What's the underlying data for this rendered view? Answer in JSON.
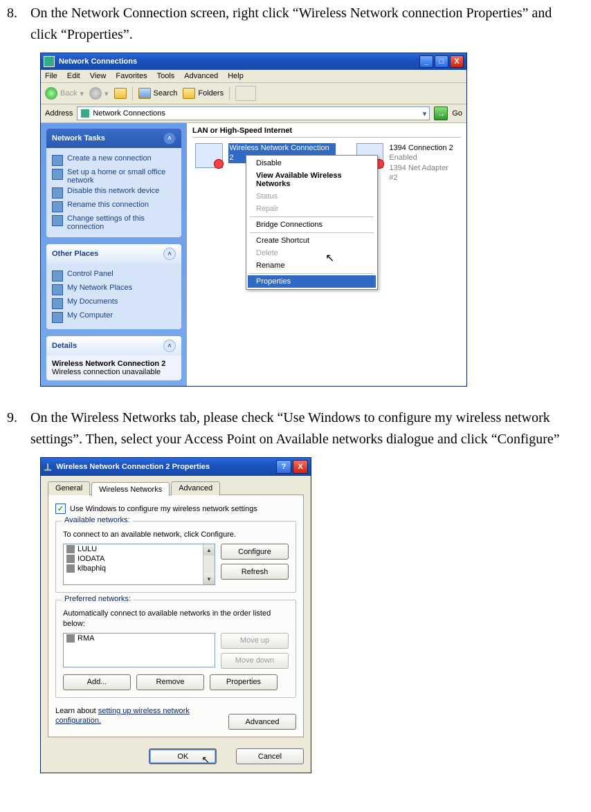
{
  "step8": {
    "num": "8.",
    "text": "On the Network Connection screen, right click “Wireless Network connection Properties” and click “Properties”."
  },
  "step9": {
    "num": "9.",
    "text": "On the Wireless Networks tab, please check “Use Windows to configure my wireless network settings”. Then, select your Access Point on Available networks dialogue and click “Configure”"
  },
  "win1": {
    "title": "Network Connections",
    "menu": [
      "File",
      "Edit",
      "View",
      "Favorites",
      "Tools",
      "Advanced",
      "Help"
    ],
    "toolbar": {
      "back": "Back",
      "search": "Search",
      "folders": "Folders"
    },
    "address": {
      "label": "Address",
      "value": "Network Connections",
      "go": "Go"
    },
    "tasks": {
      "title": "Network Tasks",
      "items": [
        "Create a new connection",
        "Set up a home or small office network",
        "Disable this network device",
        "Rename this connection",
        "Change settings of this connection"
      ]
    },
    "places": {
      "title": "Other Places",
      "items": [
        "Control Panel",
        "My Network Places",
        "My Documents",
        "My Computer"
      ]
    },
    "details": {
      "title": "Details",
      "name": "Wireless Network Connection 2",
      "status": "Wireless connection unavailable"
    },
    "section": "LAN or High-Speed Internet",
    "conn1": {
      "name": "Wireless Network Connection 2"
    },
    "conn2": {
      "name": "1394 Connection 2",
      "status": "Enabled",
      "device": "1394 Net Adapter #2"
    },
    "ctx": {
      "disable": "Disable",
      "view": "View Available Wireless Networks",
      "status": "Status",
      "repair": "Repair",
      "bridge": "Bridge Connections",
      "shortcut": "Create Shortcut",
      "delete": "Delete",
      "rename": "Rename",
      "properties": "Properties"
    }
  },
  "win2": {
    "title": "Wireless Network Connection 2 Properties",
    "tabs": {
      "general": "General",
      "wireless": "Wireless Networks",
      "advanced": "Advanced"
    },
    "check": "Use Windows to configure my wireless network settings",
    "avail": {
      "title": "Available networks:",
      "hint": "To connect to an available network, click Configure.",
      "items": [
        "LULU",
        "IODATA",
        "klbaphiq"
      ],
      "configure": "Configure",
      "refresh": "Refresh"
    },
    "pref": {
      "title": "Preferred networks:",
      "hint": "Automatically connect to available networks in the order listed below:",
      "items": [
        "RMA"
      ],
      "moveup": "Move up",
      "movedown": "Move down",
      "add": "Add...",
      "remove": "Remove",
      "props": "Properties"
    },
    "learn": {
      "pre": "Learn about ",
      "link": "setting up wireless network configuration.",
      "advanced": "Advanced"
    },
    "ok": "OK",
    "cancel": "Cancel",
    "help": "?",
    "close": "X",
    "min": "_",
    "max": "□"
  }
}
